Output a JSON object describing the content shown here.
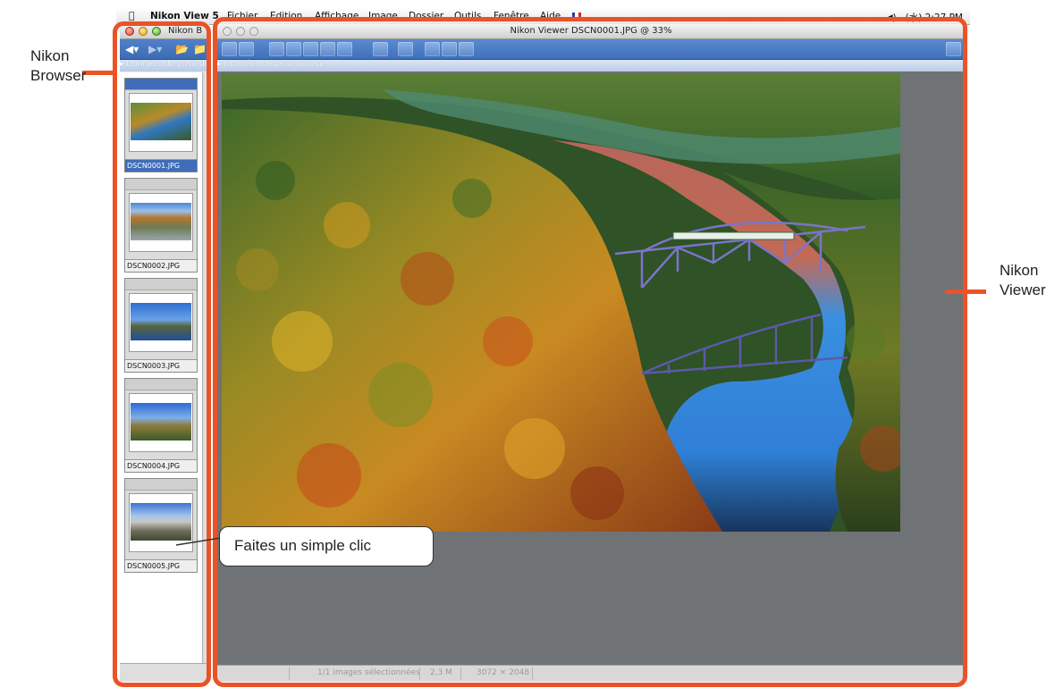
{
  "menubar": {
    "apple": "",
    "app_name": "Nikon View 5",
    "items": [
      "Fichier",
      "Edition",
      "Affichage",
      "Image",
      "Dossier",
      "Outils",
      "Fenêtre",
      "Aide"
    ],
    "volume": "◀)",
    "clock": "(水) 2:27 PM"
  },
  "browser": {
    "title": "Nikon B",
    "info_label": "Données de prise de",
    "thumbnails": [
      {
        "name": "DSCN0001.JPG",
        "selected": true
      },
      {
        "name": "DSCN0002.JPG",
        "selected": false
      },
      {
        "name": "DSCN0003.JPG",
        "selected": false
      },
      {
        "name": "DSCN0004.JPG",
        "selected": false
      },
      {
        "name": "DSCN0005.JPG",
        "selected": false
      }
    ]
  },
  "viewer": {
    "title": "Nikon Viewer DSCN0001.JPG @ 33%",
    "info_label": "Données de prise de vue",
    "status": {
      "selected": "1/1 images sélectionnées",
      "size": "2,3 M",
      "dimensions": "3072 × 2048"
    }
  },
  "annotations": {
    "browser_label_line1": "Nikon",
    "browser_label_line2": "Browser",
    "viewer_label_line1": "Nikon",
    "viewer_label_line2": "Viewer",
    "callout": "Faites un simple clic"
  },
  "colors": {
    "frame": "#ea5327",
    "toolbar": "#3f70ba",
    "viewer_background": "#6f7375"
  }
}
